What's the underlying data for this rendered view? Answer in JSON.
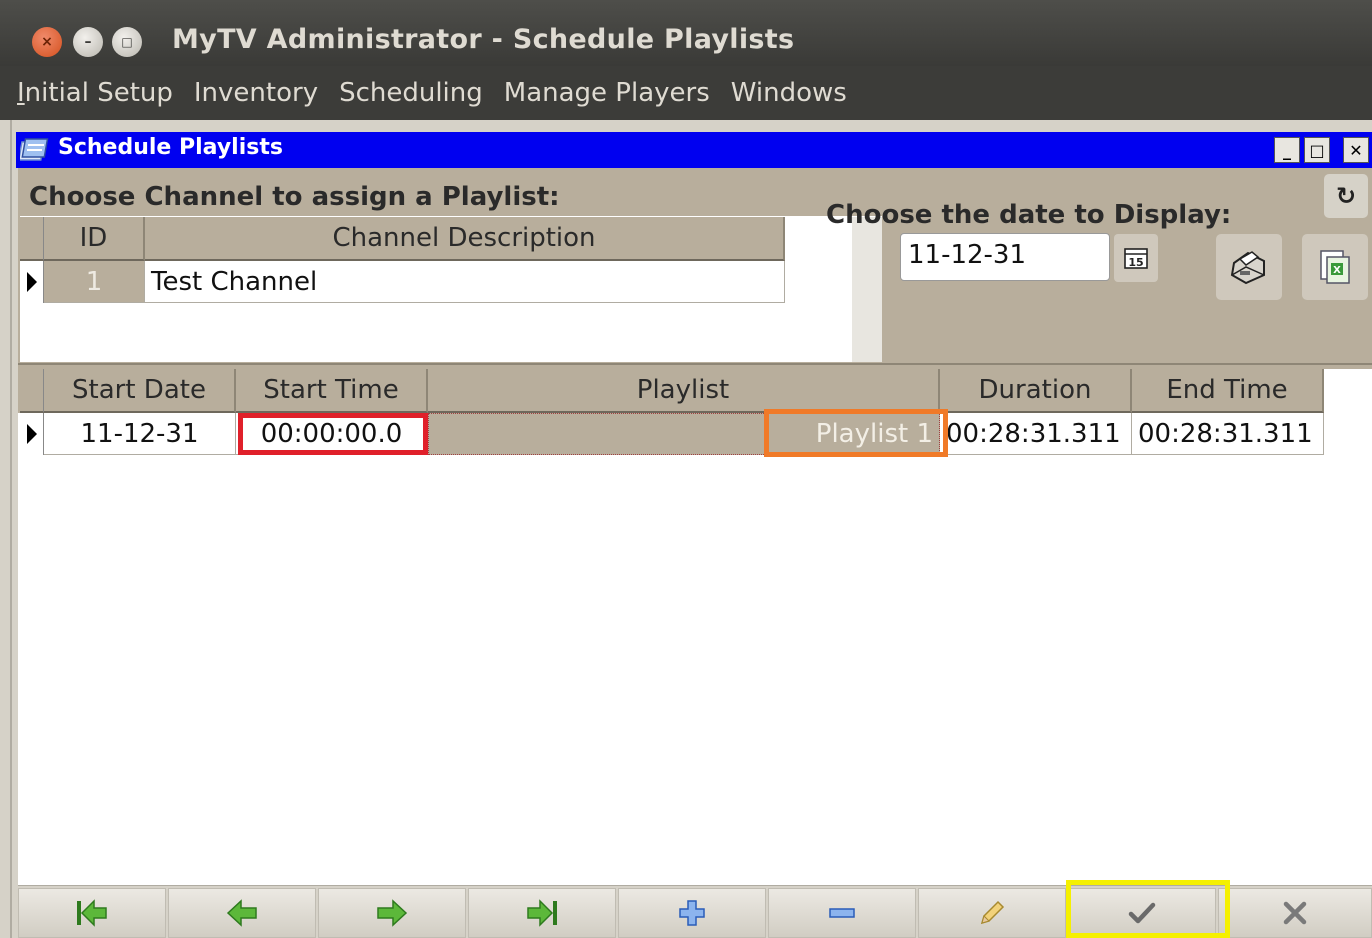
{
  "app": {
    "window_title": "MyTV Administrator - Schedule Playlists",
    "controls": {
      "close": "×",
      "minimize": "–",
      "maximize": "□"
    }
  },
  "menu": {
    "items": [
      {
        "label": "Initial Setup",
        "underline": "I",
        "rest": "nitial Setup"
      },
      {
        "label": "Inventory"
      },
      {
        "label": "Scheduling"
      },
      {
        "label": "Manage Players"
      },
      {
        "label": "Windows"
      }
    ]
  },
  "frame": {
    "title": "Schedule Playlists",
    "buttons": {
      "minimize": "_",
      "maximize": "□",
      "close": "✕"
    },
    "refresh_icon": "refresh-icon"
  },
  "channel_section": {
    "heading": "Choose Channel to assign a Playlist:",
    "columns": [
      "ID",
      "Channel Description"
    ],
    "rows": [
      {
        "id": "1",
        "description": "Test Channel"
      }
    ]
  },
  "date_section": {
    "heading": "Choose the date to Display:",
    "date_value": "11-12-31",
    "calendar_icon_label": "15"
  },
  "schedule": {
    "columns": [
      "Start Date",
      "Start Time",
      "Playlist",
      "Duration",
      "End Time"
    ],
    "rows": [
      {
        "start_date": "11-12-31",
        "start_time": "00:00:00.0",
        "playlist": "Playlist 1",
        "duration": "00:28:31.311",
        "end_time": "00:28:31.311"
      }
    ]
  },
  "toolbar": {
    "buttons": [
      "first-record-icon",
      "previous-record-icon",
      "next-record-icon",
      "last-record-icon",
      "add-icon",
      "remove-icon",
      "edit-icon",
      "save-check-icon",
      "cancel-x-icon"
    ]
  },
  "colors": {
    "frame_title_bar": "#0000f0",
    "header_bg": "#b8ae9c",
    "highlight_red": "#e0202a",
    "highlight_orange": "#f07a28",
    "highlight_yellow": "#f5f000",
    "nav_green": "#4aa02c",
    "add_blue": "#3a6ed0"
  }
}
